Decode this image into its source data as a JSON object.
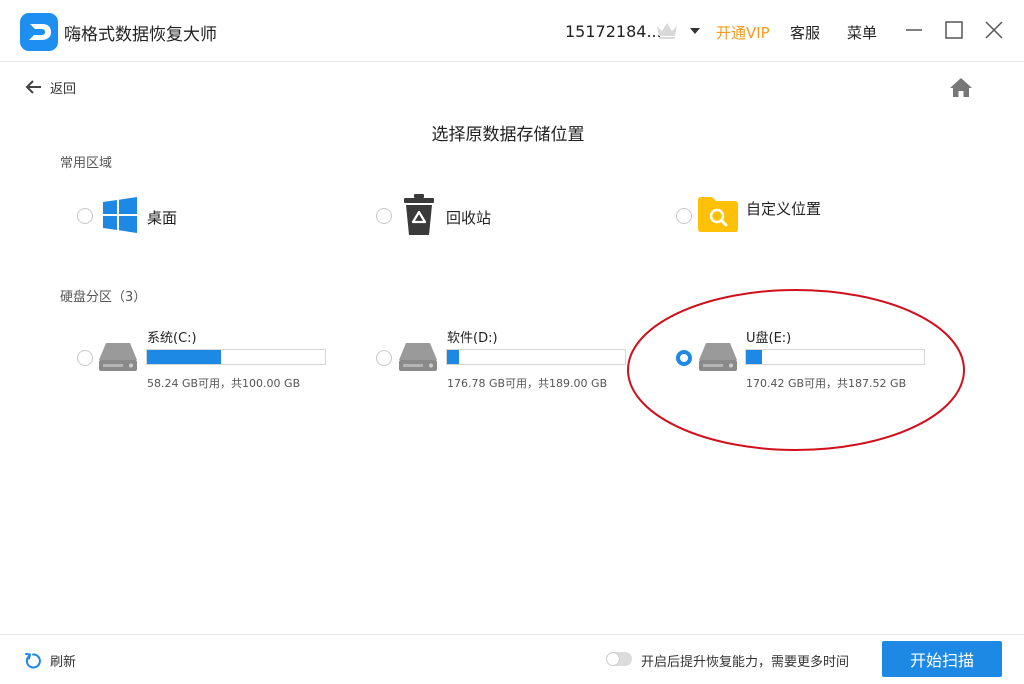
{
  "app": {
    "title": "嗨格式数据恢复大师",
    "user_id": "15172184...",
    "vip_label": "开通VIP",
    "service_label": "客服",
    "menu_label": "菜单"
  },
  "nav": {
    "back_label": "返回"
  },
  "page": {
    "title": "选择原数据存储位置"
  },
  "common": {
    "section_label": "常用区域",
    "items": [
      {
        "label": "桌面",
        "icon": "windows-icon",
        "selected": false
      },
      {
        "label": "回收站",
        "icon": "recycle-bin-icon",
        "selected": false
      },
      {
        "label": "自定义位置",
        "icon": "folder-search-icon",
        "selected": false
      }
    ]
  },
  "disks": {
    "section_label": "硬盘分区（3）",
    "items": [
      {
        "name": "系统(C:)",
        "info": "58.24 GB可用，共100.00 GB",
        "used_fraction": 0.4176,
        "selected": false
      },
      {
        "name": "软件(D:)",
        "info": "176.78 GB可用，共189.00 GB",
        "used_fraction": 0.0647,
        "selected": false
      },
      {
        "name": "U盘(E:)",
        "info": "170.42 GB可用，共187.52 GB",
        "used_fraction": 0.0912,
        "selected": true
      }
    ]
  },
  "footer": {
    "refresh_label": "刷新",
    "toggle_label": "开启后提升恢复能力，需要更多时间",
    "toggle_on": false,
    "scan_label": "开始扫描"
  },
  "colors": {
    "accent": "#1e88e5",
    "vip": "#f39a1e",
    "annotation": "#d0101c",
    "folder": "#ffc107"
  }
}
